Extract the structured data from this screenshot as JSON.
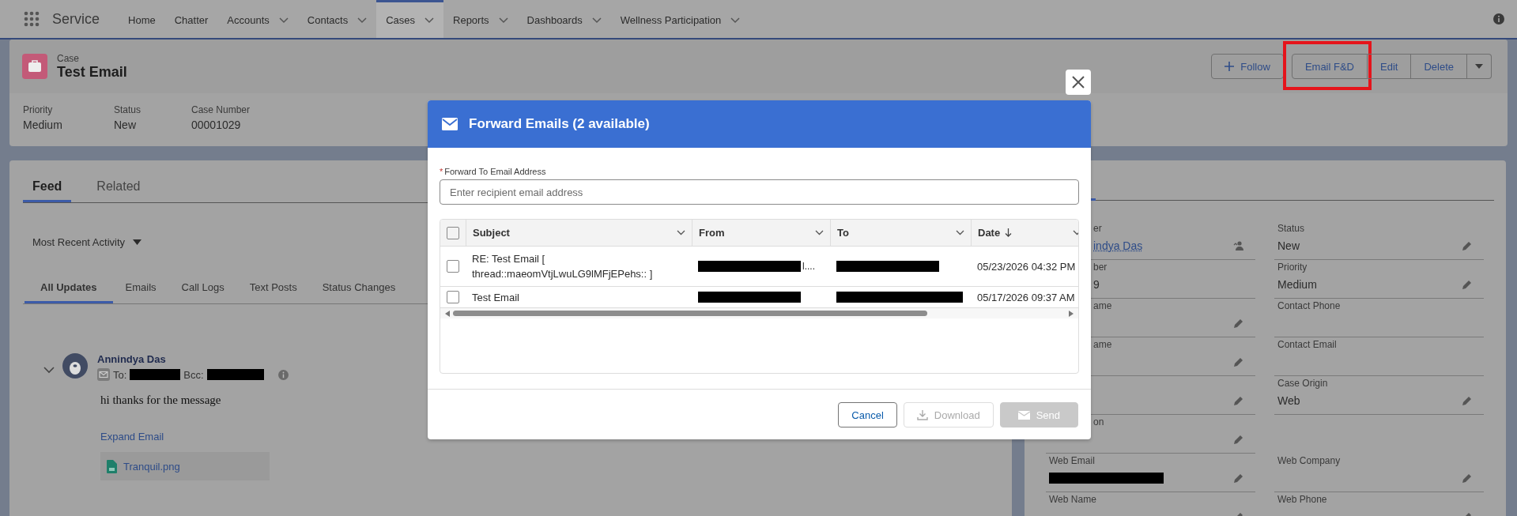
{
  "nav": {
    "app_name": "Service",
    "items": [
      {
        "label": "Home",
        "dropdown": false,
        "selected": false
      },
      {
        "label": "Chatter",
        "dropdown": false,
        "selected": false
      },
      {
        "label": "Accounts",
        "dropdown": true,
        "selected": false
      },
      {
        "label": "Contacts",
        "dropdown": true,
        "selected": false
      },
      {
        "label": "Cases",
        "dropdown": true,
        "selected": true
      },
      {
        "label": "Reports",
        "dropdown": true,
        "selected": false
      },
      {
        "label": "Dashboards",
        "dropdown": true,
        "selected": false
      },
      {
        "label": "Wellness Participation",
        "dropdown": true,
        "selected": false
      }
    ]
  },
  "record": {
    "type": "Case",
    "title": "Test Email",
    "actions": [
      {
        "kind": "follow",
        "label": "Follow",
        "highlighted": false
      },
      {
        "kind": "text",
        "label": "Email F&D",
        "highlighted": true
      },
      {
        "kind": "text",
        "label": "Edit",
        "highlighted": false
      },
      {
        "kind": "text",
        "label": "Delete",
        "highlighted": false
      },
      {
        "kind": "menu",
        "highlighted": false
      }
    ],
    "fields": [
      {
        "label": "Priority",
        "value": "Medium"
      },
      {
        "label": "Status",
        "value": "New"
      },
      {
        "label": "Case Number",
        "value": "00001029"
      }
    ]
  },
  "feed": {
    "tabs": [
      {
        "label": "Feed",
        "selected": true
      },
      {
        "label": "Related",
        "selected": false
      }
    ],
    "sort": "Most Recent Activity",
    "filters": [
      {
        "label": "All Updates",
        "selected": true
      },
      {
        "label": "Emails",
        "selected": false
      },
      {
        "label": "Call Logs",
        "selected": false
      },
      {
        "label": "Text Posts",
        "selected": false
      },
      {
        "label": "Status Changes",
        "selected": false
      }
    ],
    "post": {
      "author": "Annindya Das",
      "to_label": "To:",
      "bcc_label": "Bcc:",
      "body": "hi thanks for the message",
      "expand_link": "Expand Email",
      "attachment": "Tranquil.png"
    }
  },
  "details": {
    "fields": [
      {
        "kind": "partial",
        "label": "er",
        "value": "indya Das",
        "link": true,
        "editable": false,
        "owner_change": true
      },
      {
        "kind": "full",
        "label": "Status",
        "value": "New",
        "editable": true
      },
      {
        "kind": "partial",
        "label": "ber",
        "value": "9",
        "editable": false
      },
      {
        "kind": "full",
        "label": "Priority",
        "value": "Medium",
        "editable": true
      },
      {
        "kind": "partial",
        "label": "ame",
        "editable": true
      },
      {
        "kind": "full",
        "label": "Contact Phone",
        "editable": false
      },
      {
        "kind": "partial",
        "label": "ame",
        "editable": true
      },
      {
        "kind": "full",
        "label": "Contact Email",
        "editable": false
      },
      {
        "kind": "partial",
        "editable": true
      },
      {
        "kind": "full",
        "label": "Case Origin",
        "value": "Web",
        "editable": true
      },
      {
        "kind": "partial",
        "label": "on",
        "editable": true
      },
      {
        "kind": "blank"
      },
      {
        "kind": "full",
        "label": "Web Email",
        "redacted": true,
        "editable": true
      },
      {
        "kind": "full",
        "label": "Web Company",
        "editable": true
      },
      {
        "kind": "full",
        "label": "Web Name",
        "editable": true
      },
      {
        "kind": "full",
        "label": "Web Phone",
        "editable": true
      }
    ]
  },
  "modal": {
    "title": "Forward Emails (2 available)",
    "field": {
      "label": "Forward To Email Address",
      "required_mark": "*",
      "placeholder": "Enter recipient email address"
    },
    "select_all": {
      "checked": false
    },
    "columns": [
      {
        "label": "Subject",
        "sorted_desc": false
      },
      {
        "label": "From",
        "sorted_desc": false
      },
      {
        "label": "To",
        "sorted_desc": false
      },
      {
        "label": "Date",
        "sorted_desc": true
      }
    ],
    "rows": [
      {
        "checked": false,
        "subject": "RE: Test Email [ thread::maeomVtjLwuLG9lMFjEPehs:: ]",
        "from_tail": "l....",
        "date": "05/23/2026 04:32 PM"
      },
      {
        "checked": false,
        "subject": "Test Email",
        "date": "05/17/2026 09:37 AM"
      }
    ],
    "buttons": [
      {
        "kind": "cancel",
        "label": "Cancel",
        "disabled": false
      },
      {
        "kind": "download",
        "label": "Download",
        "disabled": true
      },
      {
        "kind": "send",
        "label": "Send",
        "disabled": true
      }
    ]
  }
}
